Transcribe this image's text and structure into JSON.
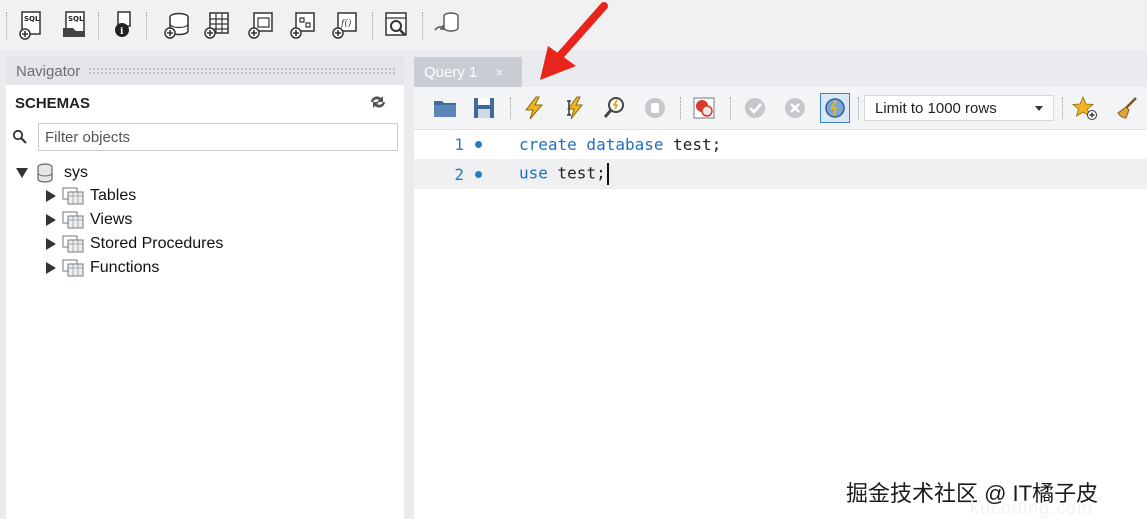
{
  "toolbar": {
    "buttons": [
      "new-sql-tab",
      "open-sql-script",
      "inspector",
      "create-schema",
      "create-table",
      "create-view",
      "create-procedure",
      "create-function",
      "search-table-data",
      "reconnect"
    ]
  },
  "navigator": {
    "title": "Navigator",
    "schemas_label": "SCHEMAS",
    "filter_placeholder": "Filter objects",
    "schema": {
      "name": "sys",
      "children": [
        "Tables",
        "Views",
        "Stored Procedures",
        "Functions"
      ]
    }
  },
  "editor": {
    "tab_label": "Query 1",
    "tab_close": "×",
    "limit_label": "Limit to 1000 rows",
    "lines": [
      {
        "no": "1",
        "keyword": "create database",
        "rest": " test;"
      },
      {
        "no": "2",
        "keyword": "use",
        "rest": " test;"
      }
    ]
  },
  "watermark": {
    "text": "掘金技术社区 @ IT橘子皮",
    "sub": "kucoding.com"
  },
  "colors": {
    "accent_blue": "#2b7bbf",
    "arrow_red": "#e8241c"
  }
}
